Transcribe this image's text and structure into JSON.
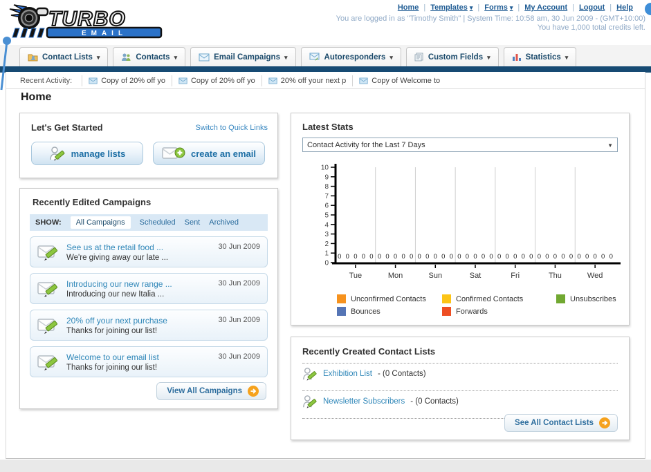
{
  "brand": {
    "name_top": "TURBO",
    "name_bottom": "EMAIL"
  },
  "header": {
    "links": [
      "Home",
      "Templates",
      "Forms",
      "My Account",
      "Logout",
      "Help"
    ],
    "login_line": "You are logged in as \"Timothy Smith\" | System Time: 10:58 am, 30 Jun 2009 - (GMT+10:00)",
    "credits_line": "You have 1,000 total credits left."
  },
  "nav": {
    "tabs": [
      {
        "label": "Contact Lists"
      },
      {
        "label": "Contacts"
      },
      {
        "label": "Email Campaigns"
      },
      {
        "label": "Autoresponders"
      },
      {
        "label": "Custom Fields"
      },
      {
        "label": "Statistics"
      }
    ]
  },
  "recent_activity": {
    "label": "Recent Activity:",
    "items": [
      "Copy of 20% off yo",
      "Copy of 20% off yo",
      "20% off your next p",
      "Copy of Welcome to"
    ]
  },
  "page_title": "Home",
  "get_started": {
    "title": "Let's Get Started",
    "switch_link": "Switch to Quick Links",
    "buttons": [
      {
        "label": "manage lists"
      },
      {
        "label": "create an email"
      }
    ]
  },
  "campaigns": {
    "title": "Recently Edited Campaigns",
    "show_label": "SHOW:",
    "filters": [
      "All Campaigns",
      "Scheduled",
      "Sent",
      "Archived"
    ],
    "active_filter": "All Campaigns",
    "items": [
      {
        "title": "See us at the retail food ...",
        "subtitle": "We're giving away our late ...",
        "date": "30 Jun 2009"
      },
      {
        "title": "Introducing our new range ...",
        "subtitle": "Introducing our new Italia ...",
        "date": "30 Jun 2009"
      },
      {
        "title": "20% off your next purchase",
        "subtitle": "Thanks for joining our list!",
        "date": "30 Jun 2009"
      },
      {
        "title": "Welcome to our email list",
        "subtitle": "Thanks for joining our list!",
        "date": "30 Jun 2009"
      }
    ],
    "view_all_label": "View All Campaigns"
  },
  "stats": {
    "title": "Latest Stats",
    "selected_option": "Contact Activity for the Last 7 Days"
  },
  "chart_data": {
    "type": "bar",
    "title": "Contact Activity for the Last 7 Days",
    "categories": [
      "Tue",
      "Mon",
      "Sun",
      "Sat",
      "Fri",
      "Thu",
      "Wed"
    ],
    "series": [
      {
        "name": "Unconfirmed Contacts",
        "color": "#f6921e",
        "values": [
          0,
          0,
          0,
          0,
          0,
          0,
          0
        ]
      },
      {
        "name": "Confirmed Contacts",
        "color": "#fcc417",
        "values": [
          0,
          0,
          0,
          0,
          0,
          0,
          0
        ]
      },
      {
        "name": "Unsubscribes",
        "color": "#71a831",
        "values": [
          0,
          0,
          0,
          0,
          0,
          0,
          0
        ]
      },
      {
        "name": "Bounces",
        "color": "#5575b5",
        "values": [
          0,
          0,
          0,
          0,
          0,
          0,
          0
        ]
      },
      {
        "name": "Forwards",
        "color": "#ee4e23",
        "values": [
          0,
          0,
          0,
          0,
          0,
          0,
          0
        ]
      }
    ],
    "ylim": [
      0,
      10
    ],
    "yticks": [
      0,
      1,
      2,
      3,
      4,
      5,
      6,
      7,
      8,
      9,
      10
    ],
    "grid": true,
    "legend_position": "bottom",
    "value_labels_shown": true
  },
  "contact_lists": {
    "title": "Recently Created Contact Lists",
    "items": [
      {
        "name": "Exhibition List",
        "count": "- (0 Contacts)"
      },
      {
        "name": "Newsletter Subscribers",
        "count": "- (0 Contacts)"
      }
    ],
    "see_all_label": "See All Contact Lists"
  },
  "colors": {
    "navy_bar": "#164a73",
    "link_blue": "#1f5c94",
    "accent_orange": "#f6a21d"
  }
}
